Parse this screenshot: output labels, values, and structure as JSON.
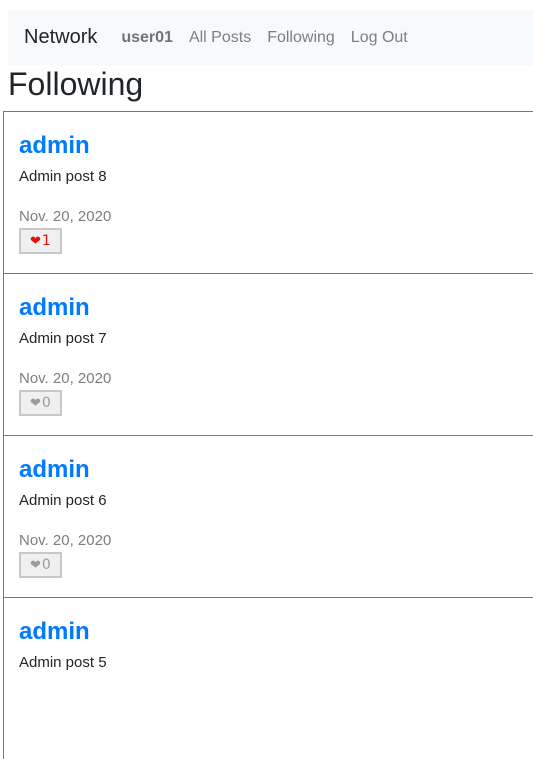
{
  "navbar": {
    "brand": "Network",
    "links": [
      {
        "label": "user01"
      },
      {
        "label": "All Posts"
      },
      {
        "label": "Following"
      },
      {
        "label": "Log Out"
      }
    ]
  },
  "page_title": "Following",
  "posts": [
    {
      "author": "admin",
      "body": "Admin post 8",
      "date": "Nov. 20, 2020",
      "likes": "1",
      "liked": true
    },
    {
      "author": "admin",
      "body": "Admin post 7",
      "date": "Nov. 20, 2020",
      "likes": "0",
      "liked": false
    },
    {
      "author": "admin",
      "body": "Admin post 6",
      "date": "Nov. 20, 2020",
      "likes": "0",
      "liked": false
    },
    {
      "author": "admin",
      "body": "Admin post 5",
      "date": "",
      "likes": "",
      "liked": false
    }
  ],
  "colors": {
    "link": "#007bff",
    "liked_heart": "#e01010",
    "unliked_heart": "#9a9a9a"
  },
  "icons": {
    "like": "heart-icon"
  }
}
